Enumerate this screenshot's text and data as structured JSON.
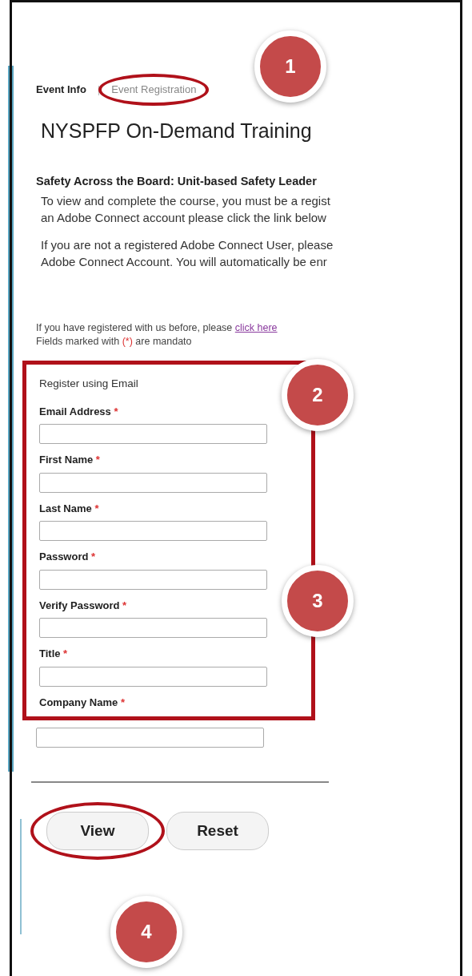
{
  "tabs": [
    {
      "label": "Event Info",
      "selected": true,
      "circled": false
    },
    {
      "label": "Event Registration",
      "selected": false,
      "circled": true
    }
  ],
  "tab_separator": "|",
  "title": "NYSPFP On-Demand Training",
  "course_heading": "Safety Across the Board: Unit-based Safety Leader",
  "paragraphs": [
    [
      "To view and complete the course, you must be a regist",
      "an Adobe Connect account please click the link below"
    ],
    [
      "If you are not a registered Adobe Connect User, please",
      "Adobe Connect Account. You will automatically be enr"
    ]
  ],
  "login_note": {
    "text": "If you have registered with us before, please ",
    "link": "click here"
  },
  "mandatory_note": {
    "before": "Fields marked with ",
    "mark": "(*)",
    "after": " are mandato"
  },
  "form": {
    "highlighted": true,
    "heading": "Register using Email",
    "fields": [
      {
        "label": "Email Address",
        "asterisk": "*"
      },
      {
        "label": "First Name",
        "asterisk": "*"
      },
      {
        "label": "Last Name",
        "asterisk": "*"
      },
      {
        "label": "Password",
        "asterisk": "*"
      },
      {
        "label": "Verify Password",
        "asterisk": "*"
      },
      {
        "label": "Title",
        "asterisk": "*"
      },
      {
        "label": "Company Name",
        "asterisk": "*"
      }
    ]
  },
  "buttons": [
    {
      "label": "View",
      "circled": true
    },
    {
      "label": "Reset",
      "circled": false
    }
  ],
  "callouts": [
    {
      "number": "1"
    },
    {
      "number": "2"
    },
    {
      "number": "3"
    },
    {
      "number": "4"
    }
  ]
}
